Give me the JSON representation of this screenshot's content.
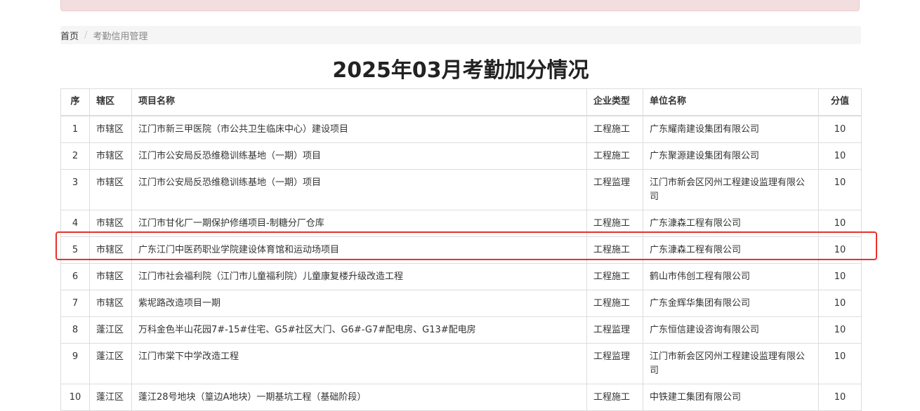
{
  "breadcrumb": {
    "home": "首页",
    "separator": "/",
    "current": "考勤信用管理"
  },
  "page_title": "2025年03月考勤加分情况",
  "table": {
    "headers": [
      "序",
      "辖区",
      "项目名称",
      "企业类型",
      "单位名称",
      "分值"
    ],
    "rows": [
      {
        "no": "1",
        "district": "市辖区",
        "project": "江门市新三甲医院（市公共卫生临床中心）建设项目",
        "type": "工程施工",
        "company": "广东耀南建设集团有限公司",
        "score": "10"
      },
      {
        "no": "2",
        "district": "市辖区",
        "project": "江门市公安局反恐维稳训练基地（一期）项目",
        "type": "工程施工",
        "company": "广东聚源建设集团有限公司",
        "score": "10"
      },
      {
        "no": "3",
        "district": "市辖区",
        "project": "江门市公安局反恐维稳训练基地（一期）项目",
        "type": "工程监理",
        "company": "江门市新会区冈州工程建设监理有限公司",
        "score": "10"
      },
      {
        "no": "4",
        "district": "市辖区",
        "project": "江门市甘化厂一期保护修缮项目-制糖分厂仓库",
        "type": "工程施工",
        "company": "广东漮森工程有限公司",
        "score": "10"
      },
      {
        "no": "5",
        "district": "市辖区",
        "project": "广东江门中医药职业学院建设体育馆和运动场项目",
        "type": "工程施工",
        "company": "广东漮森工程有限公司",
        "score": "10"
      },
      {
        "no": "6",
        "district": "市辖区",
        "project": "江门市社会福利院（江门市儿童福利院）儿童康复楼升级改造工程",
        "type": "工程施工",
        "company": "鹤山市伟创工程有限公司",
        "score": "10"
      },
      {
        "no": "7",
        "district": "市辖区",
        "project": "紫坭路改造项目一期",
        "type": "工程施工",
        "company": "广东金辉华集团有限公司",
        "score": "10"
      },
      {
        "no": "8",
        "district": "蓬江区",
        "project": "万科金色半山花园7#-15#住宅、G5#社区大门、G6#-G7#配电房、G13#配电房",
        "type": "工程监理",
        "company": "广东恒信建设咨询有限公司",
        "score": "10"
      },
      {
        "no": "9",
        "district": "蓬江区",
        "project": "江门市棠下中学改造工程",
        "type": "工程监理",
        "company": "江门市新会区冈州工程建设监理有限公司",
        "score": "10"
      },
      {
        "no": "10",
        "district": "蓬江区",
        "project": "蓬江28号地块（篁边A地块）一期基坑工程（基础阶段）",
        "type": "工程施工",
        "company": "中铁建工集团有限公司",
        "score": "10"
      }
    ]
  },
  "colors": {
    "highlight_border": "#e8302a",
    "alert_background": "#f2dede",
    "breadcrumb_background": "#f5f5f5"
  }
}
